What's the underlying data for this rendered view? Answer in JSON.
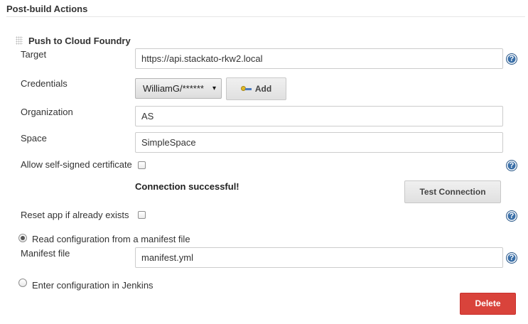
{
  "section": {
    "header": "Post-build Actions"
  },
  "block": {
    "title": "Push to Cloud Foundry"
  },
  "fields": {
    "target": {
      "label": "Target",
      "value": "https://api.stackato-rkw2.local"
    },
    "credentials": {
      "label": "Credentials",
      "selected": "WilliamG/******",
      "add_label": "Add"
    },
    "organization": {
      "label": "Organization",
      "value": "AS"
    },
    "space": {
      "label": "Space",
      "value": "SimpleSpace"
    },
    "self_signed": {
      "label": "Allow self-signed certificate",
      "checked": false
    },
    "reset_app": {
      "label": "Reset app if already exists",
      "checked": false
    },
    "manifest_file": {
      "label": "Manifest file",
      "value": "manifest.yml"
    }
  },
  "connection": {
    "status": "Connection successful!",
    "test_label": "Test Connection"
  },
  "config_mode": {
    "manifest_option": "Read configuration from a manifest file",
    "jenkins_option": "Enter configuration in Jenkins",
    "selected": "manifest"
  },
  "actions": {
    "delete_label": "Delete"
  },
  "help": {
    "glyph": "?"
  },
  "icons": {
    "select_arrow": "▾",
    "help": "help-icon",
    "key": "key-icon",
    "drag": "drag-handle-icon"
  },
  "colors": {
    "delete_button": "#d9433b",
    "help_icon": "#3a6fa8"
  }
}
